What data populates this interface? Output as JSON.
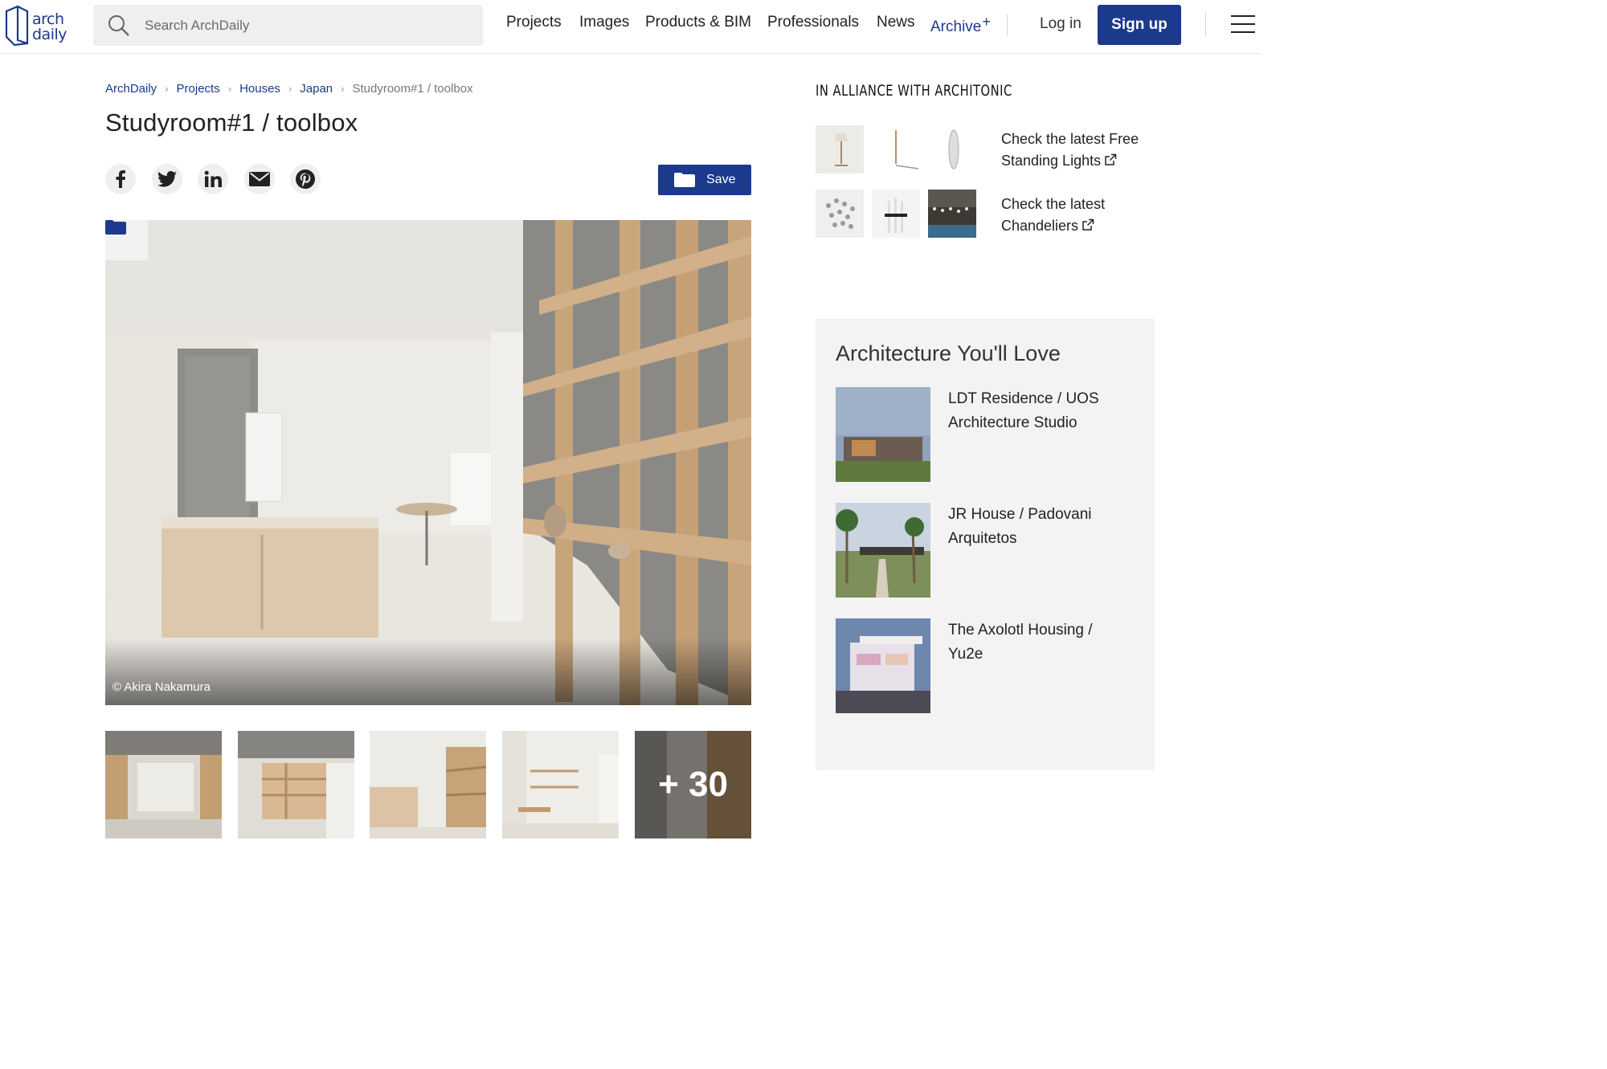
{
  "header": {
    "logo_line1": "arch",
    "logo_line2": "daily",
    "search_placeholder": "Search ArchDaily",
    "nav": [
      "Projects",
      "Images",
      "Products & BIM",
      "Professionals",
      "News",
      "Archive"
    ],
    "archive_mark": "+",
    "login_label": "Log in",
    "signup_label": "Sign up"
  },
  "breadcrumb": [
    "ArchDaily",
    "Projects",
    "Houses",
    "Japan",
    "Studyroom#1 / toolbox"
  ],
  "article": {
    "title": "Studyroom#1 / toolbox",
    "save_label": "Save",
    "photo_credit": "© Akira Nakamura",
    "more_images": "+ 30"
  },
  "alliance": {
    "title": "IN ALLIANCE WITH ARCHITONIC",
    "links": [
      "Check the latest Free Standing Lights",
      "Check the latest Chandeliers"
    ]
  },
  "love": {
    "title": "Architecture You'll Love",
    "items": [
      "LDT Residence / UOS Architecture Studio",
      "JR House / Padovani Arquitetos",
      "The Axolotl Housing / Yu2e"
    ]
  },
  "colors": {
    "brand": "#1b3a8c",
    "panel": "#f3f3f3"
  }
}
